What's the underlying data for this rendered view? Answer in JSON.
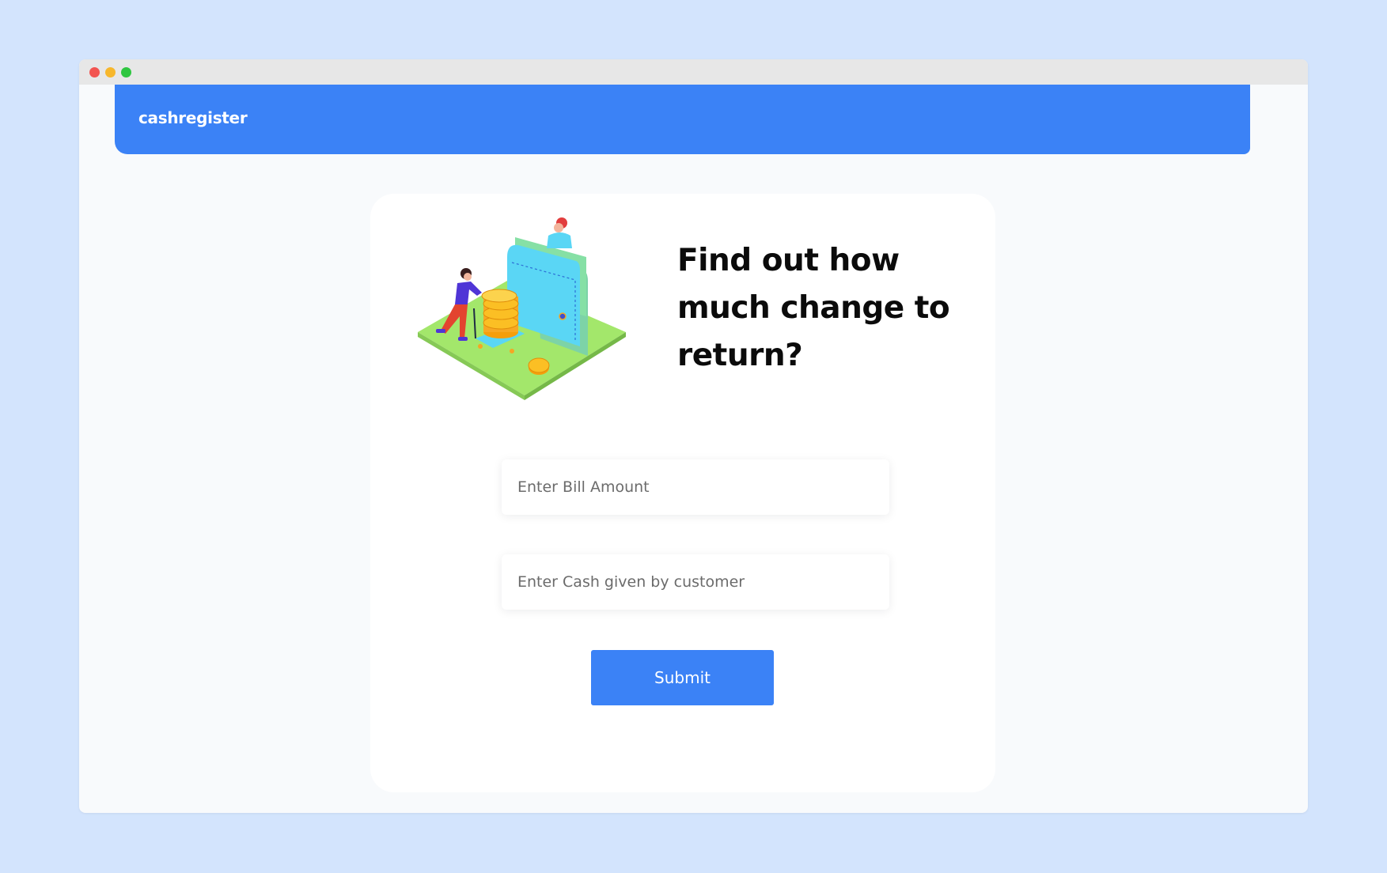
{
  "window": {
    "controls": [
      "close",
      "minimize",
      "maximize"
    ]
  },
  "navbar": {
    "brand": "cashregister",
    "color": "#3b82f6"
  },
  "card": {
    "heading": "Find out how much change to return?",
    "illustration": "wallet-coins-illustration",
    "bill_input": {
      "placeholder": "Enter Bill Amount",
      "value": ""
    },
    "cash_input": {
      "placeholder": "Enter Cash given by customer",
      "value": ""
    },
    "submit_label": "Submit"
  },
  "colors": {
    "page_background": "#d3e4fd",
    "accent": "#3b82f6",
    "window_background": "#f8fafc",
    "card_background": "#ffffff"
  }
}
